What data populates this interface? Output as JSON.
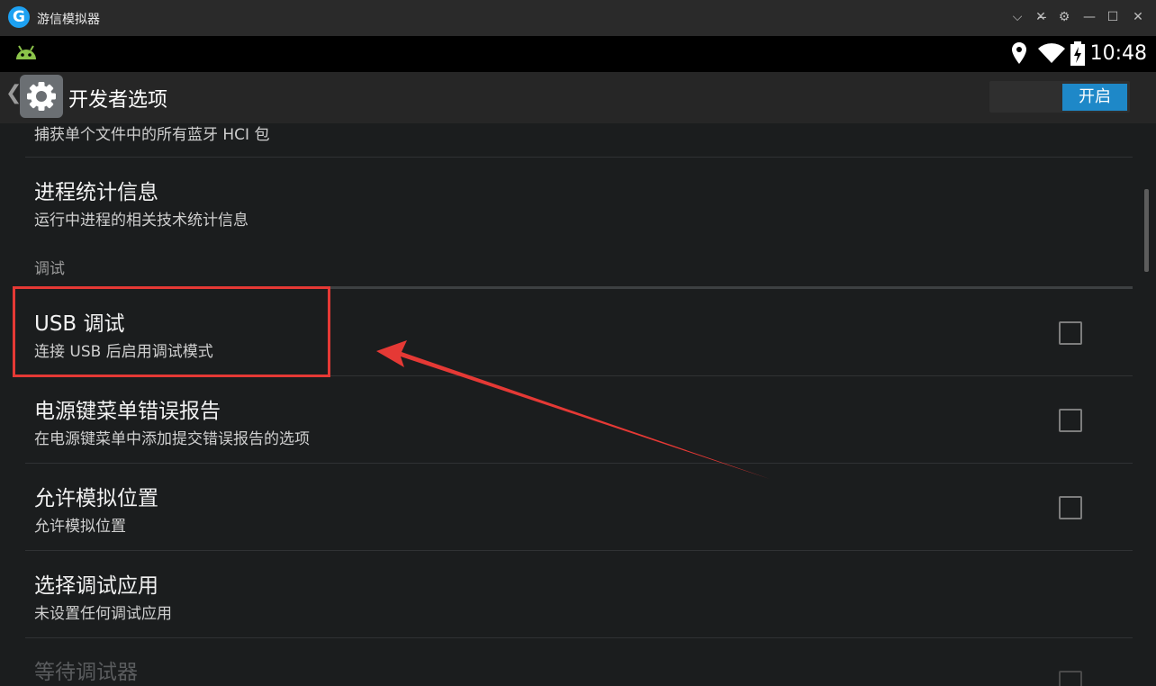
{
  "window": {
    "title": "游信模拟器",
    "logo_letter": "G",
    "controls": [
      "⌵",
      "✕̶",
      "⚙",
      "—",
      "☐",
      "✕"
    ]
  },
  "status_bar": {
    "time": "10:48",
    "icons": [
      "android-debug-icon",
      "location-icon",
      "wifi-icon",
      "battery-charging-icon"
    ]
  },
  "action_bar": {
    "back_glyph": "❮",
    "title": "开发者选项",
    "toggle_label": "开启",
    "toggle_on": true
  },
  "list": {
    "partial_top_summary": "捕获单个文件中的所有蓝牙 HCI 包",
    "items": [
      {
        "title": "进程统计信息",
        "summary": "运行中进程的相关技术统计信息"
      }
    ],
    "category": "调试",
    "debug_items": [
      {
        "title": "USB 调试",
        "summary": "连接 USB 后启用调试模式",
        "checked": false
      },
      {
        "title": "电源键菜单错误报告",
        "summary": "在电源键菜单中添加提交错误报告的选项",
        "checked": false
      },
      {
        "title": "允许模拟位置",
        "summary": "允许模拟位置",
        "checked": false
      },
      {
        "title": "选择调试应用",
        "summary": "未设置任何调试应用"
      },
      {
        "title": "等待调试器",
        "checked": false,
        "disabled": true
      }
    ]
  },
  "colors": {
    "accent": "#1e88c8",
    "highlight": "#e53935",
    "list_bg": "#1b1d1e"
  }
}
